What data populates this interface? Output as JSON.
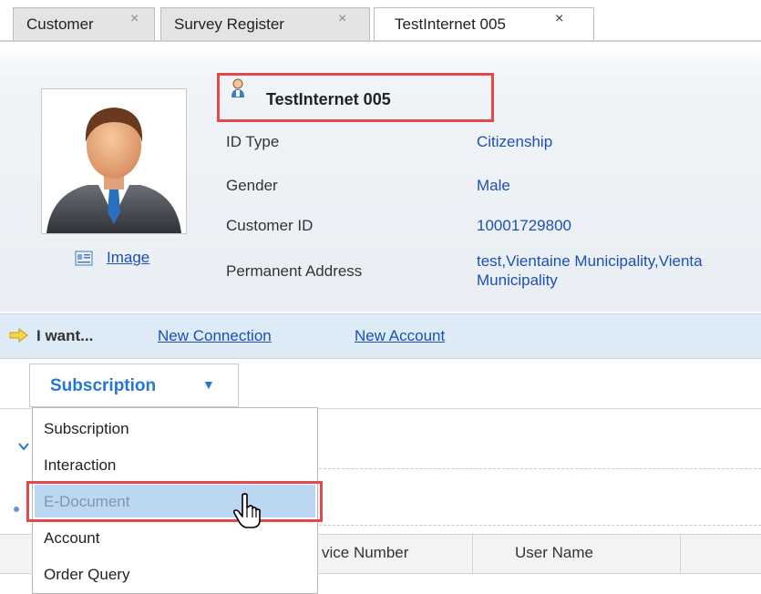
{
  "tabs": [
    {
      "label": "Customer",
      "close": "×"
    },
    {
      "label": "Survey Register",
      "close": "×"
    },
    {
      "label": "TestInternet 005",
      "close": "×"
    }
  ],
  "customer": {
    "name": "TestInternet 005",
    "image_link": "Image",
    "fields": [
      {
        "label": "ID Type",
        "value": "Citizenship"
      },
      {
        "label": "Gender",
        "value": "Male"
      },
      {
        "label": "Customer ID",
        "value": "10001729800"
      },
      {
        "label": "Permanent Address",
        "value_line1": "test,Vientaine Municipality,Vienta",
        "value_line2": "Municipality"
      }
    ]
  },
  "iwant": {
    "label": "I want...",
    "links": [
      "New Connection",
      "New Account"
    ]
  },
  "dropdown": {
    "selected": "Subscription",
    "caret": "▼",
    "options": [
      "Subscription",
      "Interaction",
      "E-Document",
      "Account",
      "Order Query"
    ],
    "highlighted": "E-Document"
  },
  "table": {
    "columns": [
      "vice Number",
      "User Name"
    ]
  },
  "colors": {
    "link": "#1c4fb8",
    "accent": "#2577cf",
    "highlight_box": "#e24a4a",
    "menu_hover": "#bcd7f1"
  }
}
